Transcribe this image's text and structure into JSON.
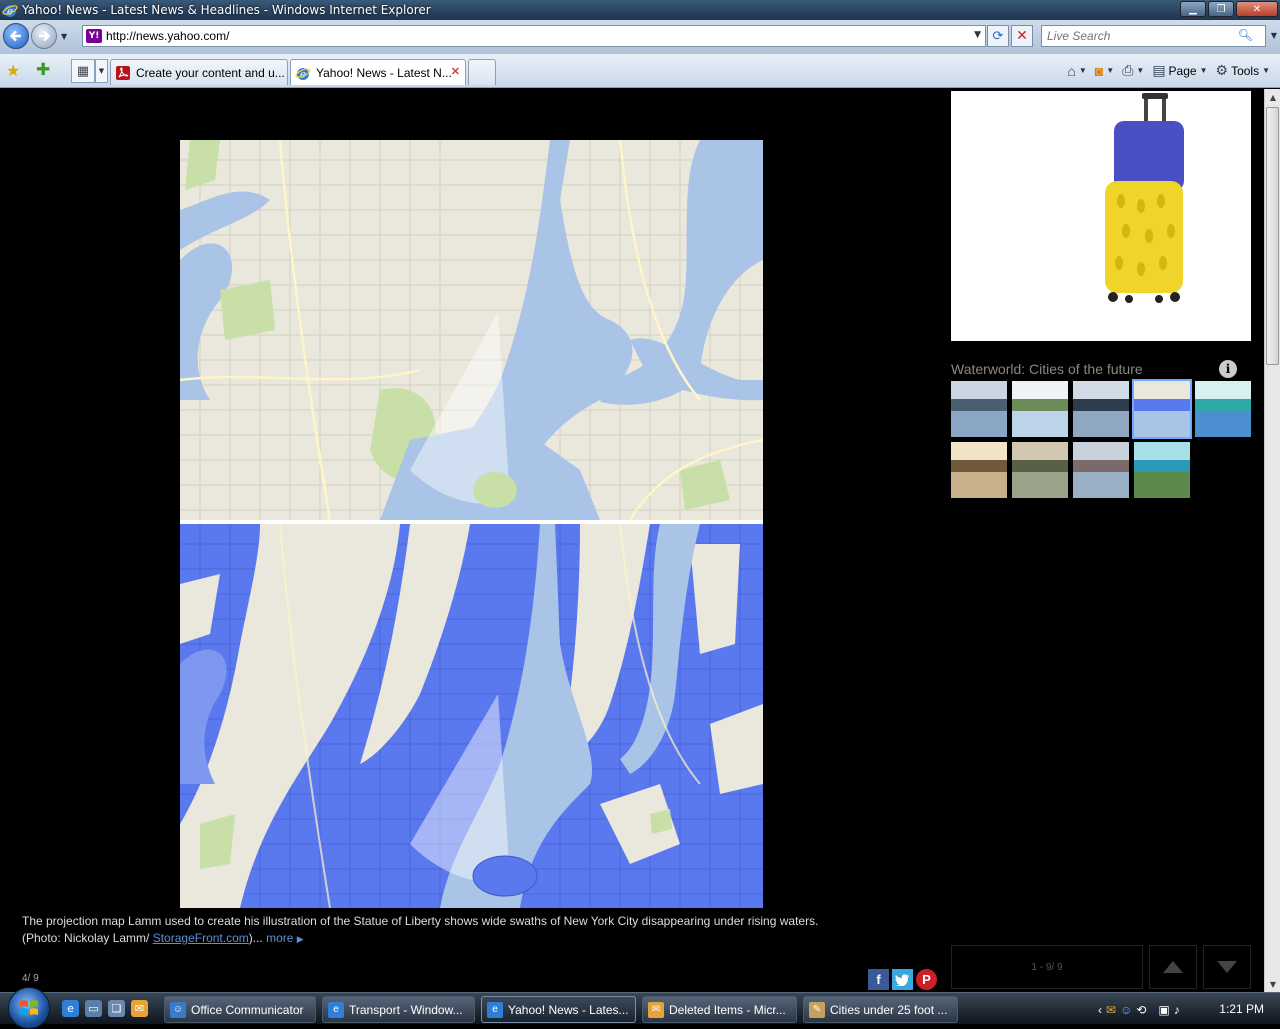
{
  "window": {
    "title": "Yahoo! News - Latest News & Headlines - Windows Internet Explorer",
    "buttons": [
      "minimize",
      "maximize",
      "close"
    ]
  },
  "address_bar": {
    "url": "http://news.yahoo.com/",
    "search_placeholder": "Live Search"
  },
  "tabs": [
    {
      "label": "Create your content and u...",
      "active": false
    },
    {
      "label": "Yahoo! News - Latest N...",
      "active": true
    },
    {
      "label": "",
      "active": false
    }
  ],
  "command_bar": {
    "page_label": "Page",
    "tools_label": "Tools"
  },
  "slideshow": {
    "caption": "The projection map Lamm used to create his illustration of the Statue of Liberty shows wide swaths of New York City disappearing under rising waters.",
    "photo_credit_prefix": "(Photo: Nickolay Lamm/ ",
    "photo_credit_link": "StorageFront.com",
    "photo_credit_suffix": ")...",
    "more_label": "more",
    "counter": "4/ 9",
    "gallery_title": "Waterworld: Cities of the future",
    "pager_label": "1 - 9/ 9",
    "active_thumb_index": 3,
    "thumb_count": 9
  },
  "taskbar": {
    "items": [
      {
        "label": "Office Communicator",
        "active": false
      },
      {
        "label": "Transport - Window...",
        "active": false
      },
      {
        "label": "Yahoo! News - Lates...",
        "active": true
      },
      {
        "label": "Deleted Items - Micr...",
        "active": false
      },
      {
        "label": "Cities under 25 foot ...",
        "active": false
      }
    ],
    "clock": "1:21 PM"
  },
  "colors": {
    "water_normal": "#a9c4e6",
    "water_flood": "#5b79ee",
    "land": "#eae7dc",
    "park": "#c9dfa8",
    "link": "#5c8fd8"
  }
}
